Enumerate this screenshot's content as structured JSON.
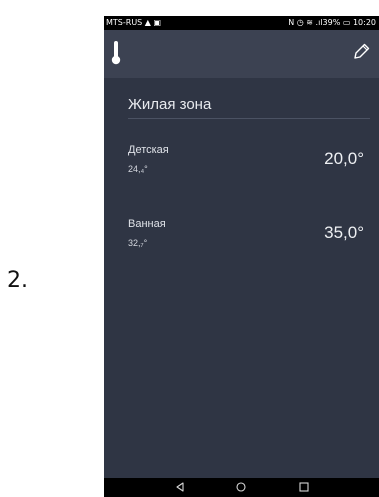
{
  "figure_label": "2.",
  "status_bar": {
    "left_text": "MTS-RUS ▲ ▣",
    "right_text": "N ◷ ≋ .ıl39% ▭ 10:20"
  },
  "app_bar": {
    "left_icon": "thermometer-icon",
    "right_icon": "pencil-icon"
  },
  "zone": {
    "title": "Жилая зона",
    "rooms": [
      {
        "name": "Детская",
        "current": "24,₄°",
        "target": "20,0°"
      },
      {
        "name": "Ванная",
        "current": "32,₇°",
        "target": "35,0°"
      }
    ]
  },
  "nav_bar": {
    "back_icon": "back-triangle-icon",
    "home_icon": "home-circle-icon",
    "recent_icon": "recent-square-icon"
  }
}
